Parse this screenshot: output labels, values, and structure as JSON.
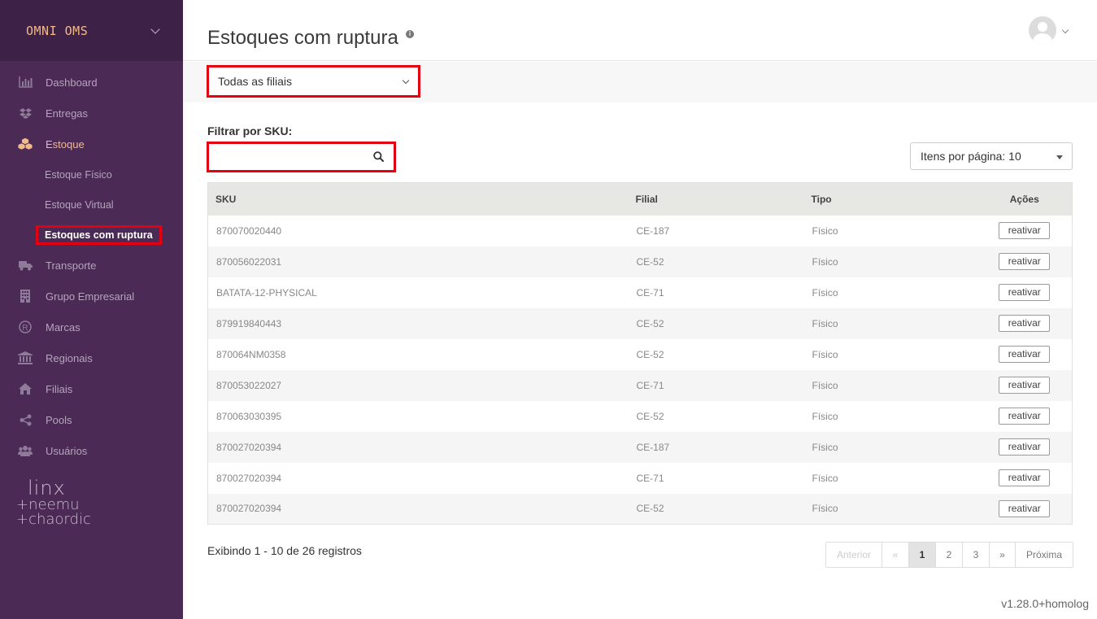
{
  "sidebar": {
    "brand": "OMNI OMS",
    "items": [
      {
        "label": "Dashboard"
      },
      {
        "label": "Entregas"
      },
      {
        "label": "Estoque"
      },
      {
        "label": "Transporte"
      },
      {
        "label": "Grupo Empresarial"
      },
      {
        "label": "Marcas"
      },
      {
        "label": "Regionais"
      },
      {
        "label": "Filiais"
      },
      {
        "label": "Pools"
      },
      {
        "label": "Usuários"
      }
    ],
    "subitems": [
      {
        "label": "Estoque Físico"
      },
      {
        "label": "Estoque Virtual"
      },
      {
        "label": "Estoques com ruptura"
      }
    ],
    "logo": {
      "line1": "linx",
      "line2": "+neemu",
      "line3": "+chaordic"
    }
  },
  "header": {
    "title": "Estoques com ruptura",
    "info": "i"
  },
  "filters": {
    "branch_value": "Todas as filiais",
    "sku_label": "Filtrar por SKU:",
    "sku_value": "",
    "per_page_label": "Itens por página: 10"
  },
  "table": {
    "columns": [
      "SKU",
      "Filial",
      "Tipo",
      "Ações"
    ],
    "rows": [
      {
        "sku": "870070020440",
        "filial": "CE-187",
        "tipo": "Físico",
        "action": "reativar"
      },
      {
        "sku": "870056022031",
        "filial": "CE-52",
        "tipo": "Físico",
        "action": "reativar"
      },
      {
        "sku": "BATATA-12-PHYSICAL",
        "filial": "CE-71",
        "tipo": "Físico",
        "action": "reativar"
      },
      {
        "sku": "879919840443",
        "filial": "CE-52",
        "tipo": "Físico",
        "action": "reativar"
      },
      {
        "sku": "870064NM0358",
        "filial": "CE-52",
        "tipo": "Físico",
        "action": "reativar"
      },
      {
        "sku": "870053022027",
        "filial": "CE-71",
        "tipo": "Físico",
        "action": "reativar"
      },
      {
        "sku": "870063030395",
        "filial": "CE-52",
        "tipo": "Físico",
        "action": "reativar"
      },
      {
        "sku": "870027020394",
        "filial": "CE-187",
        "tipo": "Físico",
        "action": "reativar"
      },
      {
        "sku": "870027020394",
        "filial": "CE-71",
        "tipo": "Físico",
        "action": "reativar"
      },
      {
        "sku": "870027020394",
        "filial": "CE-52",
        "tipo": "Físico",
        "action": "reativar"
      }
    ]
  },
  "footer": {
    "summary": "Exibindo 1 - 10 de 26 registros",
    "pagination": {
      "previous": "Anterior",
      "first": "«",
      "pages": [
        "1",
        "2",
        "3"
      ],
      "last": "»",
      "next": "Próxima"
    },
    "version": "v1.28.0+homolog"
  },
  "colors": {
    "sidebar_bg": "#4b2a55",
    "brand_bg": "#3e2147",
    "accent": "#f2b98a",
    "highlight_border": "#e3000f"
  }
}
